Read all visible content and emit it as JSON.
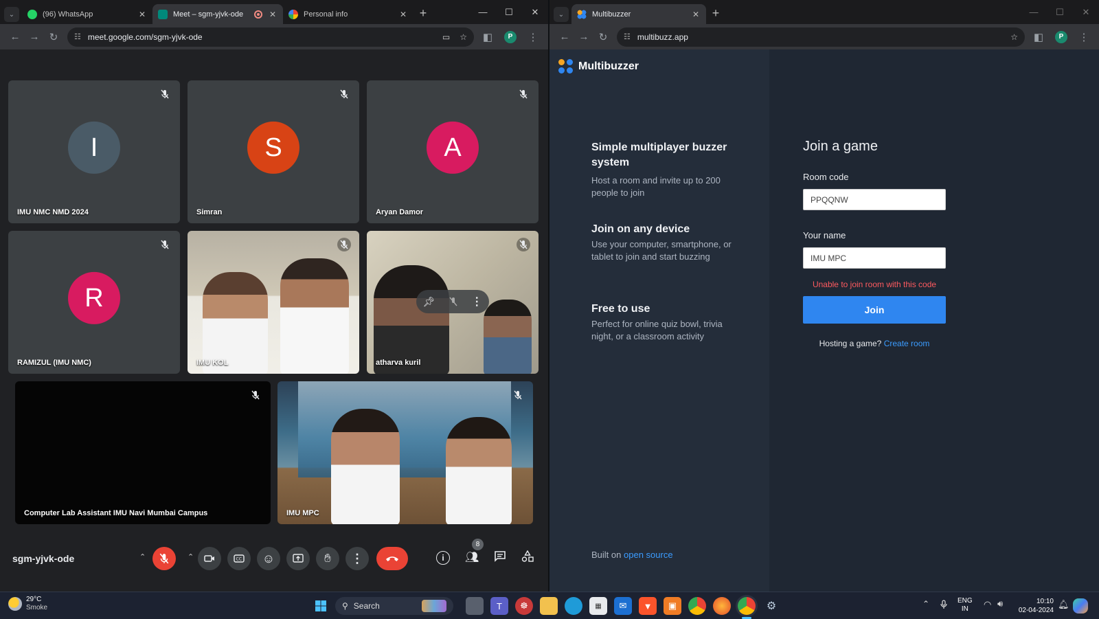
{
  "left_browser": {
    "tabs": [
      {
        "title": "(96) WhatsApp",
        "color": "#25d366"
      },
      {
        "title": "Meet – sgm-yjvk-ode",
        "color": "#00897b"
      },
      {
        "title": "Personal info",
        "color": "#4285f4"
      }
    ],
    "url": "meet.google.com/sgm-yjvk-ode",
    "profile_initial": "P"
  },
  "meet": {
    "participants": [
      {
        "name": "IMU NMC NMD 2024",
        "initial": "I",
        "color": "#4a5b67"
      },
      {
        "name": "Simran",
        "initial": "S",
        "color": "#d84315"
      },
      {
        "name": "Aryan Damor",
        "initial": "A",
        "color": "#d81b60"
      },
      {
        "name": "RAMIZUL (IMU NMC)",
        "initial": "R",
        "color": "#d81b60"
      },
      {
        "name": "IMU KOL"
      },
      {
        "name": "atharva kuril"
      },
      {
        "name": "Computer Lab Assistant IMU Navi Mumbai Campus"
      },
      {
        "name": "IMU MPC"
      }
    ],
    "meeting_code": "sgm-yjvk-ode",
    "people_count": "8",
    "end_call_color": "#ea4335"
  },
  "right_browser": {
    "tab_title": "Multibuzzer",
    "url": "multibuzz.app",
    "profile_initial": "P"
  },
  "multibuzzer": {
    "brand": "Multibuzzer",
    "features": [
      {
        "title": "Simple multiplayer buzzer system",
        "desc": "Host a room and invite up to 200 people to join"
      },
      {
        "title": "Join on any device",
        "desc": "Use your computer, smartphone, or tablet to join and start buzzing"
      },
      {
        "title": "Free to use",
        "desc": "Perfect for online quiz bowl, trivia night, or a classroom activity"
      }
    ],
    "built_on": "Built on",
    "open_source_link": "open source",
    "join_heading": "Join a game",
    "room_code_label": "Room code",
    "room_code_value": "PPQQNW",
    "name_label": "Your name",
    "name_value": "IMU MPC",
    "error": "Unable to join room with this code",
    "join_button": "Join",
    "hosting_text": "Hosting a game?",
    "create_room_link": "Create room",
    "accent": "#2f86f0",
    "error_color": "#ff5a5f"
  },
  "taskbar": {
    "weather_temp": "29°C",
    "weather_desc": "Smoke",
    "search": "Search",
    "lang1": "ENG",
    "lang2": "IN",
    "time": "10:10",
    "date": "02-04-2024"
  }
}
